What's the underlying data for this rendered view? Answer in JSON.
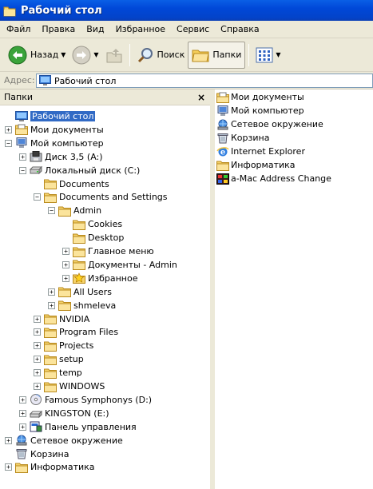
{
  "window": {
    "title": "Рабочий стол"
  },
  "menu": [
    "Файл",
    "Правка",
    "Вид",
    "Избранное",
    "Сервис",
    "Справка"
  ],
  "toolbar": {
    "back": "Назад",
    "search": "Поиск",
    "folders": "Папки"
  },
  "address": {
    "label": "Адрес:",
    "value": "Рабочий стол"
  },
  "folders_pane": {
    "title": "Папки",
    "close": "×",
    "tree": [
      {
        "label": "Рабочий стол",
        "level": 0,
        "exp": "",
        "icon": "desktop",
        "selected": true
      },
      {
        "label": "Мои документы",
        "level": 0,
        "exp": "+",
        "icon": "mydocs"
      },
      {
        "label": "Мой компьютер",
        "level": 0,
        "exp": "-",
        "icon": "computer"
      },
      {
        "label": "Диск 3,5 (A:)",
        "level": 1,
        "exp": "+",
        "icon": "floppy"
      },
      {
        "label": "Локальный диск (C:)",
        "level": 1,
        "exp": "-",
        "icon": "harddisk"
      },
      {
        "label": "Documents",
        "level": 2,
        "exp": "",
        "icon": "folder"
      },
      {
        "label": "Documents and Settings",
        "level": 2,
        "exp": "-",
        "icon": "folder"
      },
      {
        "label": "Admin",
        "level": 3,
        "exp": "-",
        "icon": "folder"
      },
      {
        "label": "Cookies",
        "level": 4,
        "exp": "",
        "icon": "folder"
      },
      {
        "label": "Desktop",
        "level": 4,
        "exp": "",
        "icon": "folder"
      },
      {
        "label": "Главное меню",
        "level": 4,
        "exp": "+",
        "icon": "folder"
      },
      {
        "label": "Документы - Admin",
        "level": 4,
        "exp": "+",
        "icon": "folder"
      },
      {
        "label": "Избранное",
        "level": 4,
        "exp": "+",
        "icon": "star"
      },
      {
        "label": "All Users",
        "level": 3,
        "exp": "+",
        "icon": "folder"
      },
      {
        "label": "shmeleva",
        "level": 3,
        "exp": "+",
        "icon": "folder"
      },
      {
        "label": "NVIDIA",
        "level": 2,
        "exp": "+",
        "icon": "folder"
      },
      {
        "label": "Program Files",
        "level": 2,
        "exp": "+",
        "icon": "folder"
      },
      {
        "label": "Projects",
        "level": 2,
        "exp": "+",
        "icon": "folder"
      },
      {
        "label": "setup",
        "level": 2,
        "exp": "+",
        "icon": "folder"
      },
      {
        "label": "temp",
        "level": 2,
        "exp": "+",
        "icon": "folder"
      },
      {
        "label": "WINDOWS",
        "level": 2,
        "exp": "+",
        "icon": "folder"
      },
      {
        "label": "Famous Symphonys (D:)",
        "level": 1,
        "exp": "+",
        "icon": "cd"
      },
      {
        "label": "KINGSTON (E:)",
        "level": 1,
        "exp": "+",
        "icon": "removable"
      },
      {
        "label": "Панель управления",
        "level": 1,
        "exp": "+",
        "icon": "controlpanel"
      },
      {
        "label": "Сетевое окружение",
        "level": 0,
        "exp": "+",
        "icon": "network"
      },
      {
        "label": "Корзина",
        "level": 0,
        "exp": "",
        "icon": "recycle"
      },
      {
        "label": "Информатика",
        "level": 0,
        "exp": "+",
        "icon": "folder"
      }
    ]
  },
  "content_items": [
    {
      "label": "Мои документы",
      "icon": "mydocs"
    },
    {
      "label": "Мой компьютер",
      "icon": "computer"
    },
    {
      "label": "Сетевое окружение",
      "icon": "network"
    },
    {
      "label": "Корзина",
      "icon": "recycle"
    },
    {
      "label": "Internet Explorer",
      "icon": "ie"
    },
    {
      "label": "Информатика",
      "icon": "folder"
    },
    {
      "label": "a-Mac Address Change",
      "icon": "app"
    }
  ]
}
